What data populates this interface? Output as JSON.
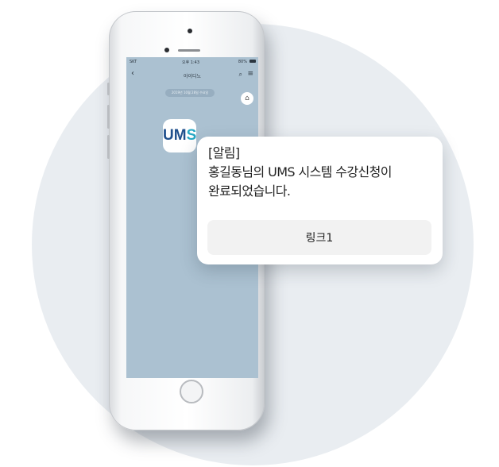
{
  "phone": {
    "carrier": "SKT",
    "time": "오후 1:43",
    "battery": "80%",
    "chat_title": "아이디노",
    "back_icon": "back-chevron-icon",
    "date_pill": "2019년 10월 28일 수요일",
    "home_icon": "home-icon"
  },
  "logo": {
    "left": "UM",
    "right": "S"
  },
  "message": {
    "line1": "[알림]",
    "line2": "홍길동님의 UMS 시스템 수강신청이",
    "line3": "완료되었습니다.",
    "link_label": "링크1"
  },
  "colors": {
    "screen_bg": "#abc1d1",
    "circle_bg": "#e9edf1",
    "logo_dark": "#1f4f8c",
    "logo_light": "#27a8c5"
  }
}
